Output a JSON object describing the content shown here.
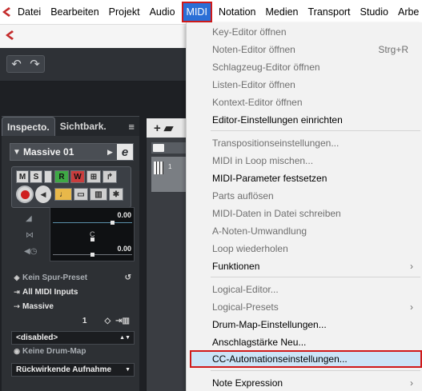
{
  "menubar": {
    "items": [
      "Datei",
      "Bearbeiten",
      "Projekt",
      "Audio",
      "MIDI",
      "Notation",
      "Medien",
      "Transport",
      "Studio",
      "Arbe"
    ],
    "active": "MIDI"
  },
  "inspector": {
    "tabs": [
      "Inspecto.",
      "Sichtbark."
    ],
    "track_name": "Massive 01",
    "edit_glyph": "e",
    "buttons": {
      "m": "M",
      "s": "S",
      "r": "R",
      "w": "W"
    },
    "fader_values": [
      "0.00",
      "0.00"
    ],
    "pan_center": "C",
    "rows": {
      "preset": "Kein Spur-Preset",
      "input": "All MIDI Inputs",
      "output": "Massive",
      "channel": "1",
      "disabled": "<disabled>",
      "drum_map": "Keine Drum-Map",
      "retro": "Rückwirkende Aufnahme"
    }
  },
  "tracklist": {
    "track_number": "1"
  },
  "midi_menu": {
    "items": [
      {
        "label": "Key-Editor öffnen",
        "enabled": false
      },
      {
        "label": "Noten-Editor öffnen",
        "enabled": false,
        "shortcut": "Strg+R"
      },
      {
        "label": "Schlagzeug-Editor öffnen",
        "enabled": false
      },
      {
        "label": "Listen-Editor öffnen",
        "enabled": false
      },
      {
        "label": "Kontext-Editor öffnen",
        "enabled": false
      },
      {
        "label": "Editor-Einstellungen einrichten",
        "enabled": true
      },
      {
        "label": "Transpositionseinstellungen...",
        "enabled": false
      },
      {
        "label": "MIDI in Loop mischen...",
        "enabled": false
      },
      {
        "label": "MIDI-Parameter festsetzen",
        "enabled": true
      },
      {
        "label": "Parts auflösen",
        "enabled": false
      },
      {
        "label": "MIDI-Daten in Datei schreiben",
        "enabled": false
      },
      {
        "label": "A-Noten-Umwandlung",
        "enabled": false
      },
      {
        "label": "Loop wiederholen",
        "enabled": false
      },
      {
        "label": "Funktionen",
        "enabled": true,
        "submenu": true
      },
      {
        "label": "Logical-Editor...",
        "enabled": false
      },
      {
        "label": "Logical-Presets",
        "enabled": false,
        "submenu": true
      },
      {
        "label": "Drum-Map-Einstellungen...",
        "enabled": true
      },
      {
        "label": "Anschlagstärke Neu...",
        "enabled": true
      },
      {
        "label": "CC-Automationseinstellungen...",
        "enabled": true,
        "highlighted": true
      },
      {
        "label": "Note Expression",
        "enabled": true,
        "submenu": true
      }
    ]
  },
  "colors": {
    "accent": "#2b6fd6",
    "highlight_outline": "#d01a1a",
    "menu_bg": "#f2f2f2",
    "hover_bg": "#cce4f7"
  }
}
